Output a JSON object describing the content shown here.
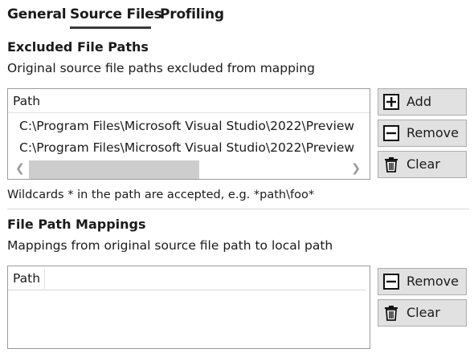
{
  "tabs": [
    {
      "label": "General",
      "active": false
    },
    {
      "label": "Source Files",
      "active": true
    },
    {
      "label": "Profiling",
      "active": false
    }
  ],
  "excluded": {
    "heading": "Excluded File Paths",
    "description": "Original source file paths excluded from mapping",
    "column_header": "Path",
    "rows": [
      "C:\\Program Files\\Microsoft Visual Studio\\2022\\Preview",
      "C:\\Program Files\\Microsoft Visual Studio\\2022\\Preview"
    ],
    "hint": "Wildcards * in the path are accepted, e.g. *path\\foo*",
    "buttons": {
      "add": "Add",
      "remove": "Remove",
      "clear": "Clear"
    }
  },
  "mappings": {
    "heading": "File Path Mappings",
    "description": "Mappings from original source file path to local path",
    "column_header": "Path",
    "buttons": {
      "remove": "Remove",
      "clear": "Clear"
    }
  },
  "icons": {
    "add": "plus-box-icon",
    "remove": "minus-box-icon",
    "clear": "trash-icon"
  }
}
